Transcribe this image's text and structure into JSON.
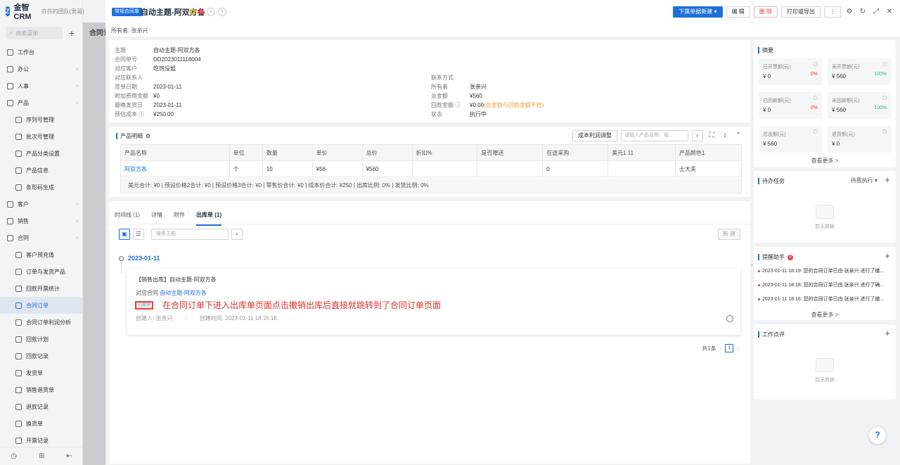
{
  "app": {
    "logo": "金智CRM",
    "team": "芬芬的团队(男哥)",
    "search_placeholder": "搜索菜单",
    "bg_title": "合同订"
  },
  "sidebar": {
    "items": [
      {
        "label": "工作台",
        "sub": false,
        "arrow": false,
        "active": false
      },
      {
        "label": "办公",
        "sub": false,
        "arrow": true,
        "active": false
      },
      {
        "label": "人事",
        "sub": false,
        "arrow": true,
        "active": false
      },
      {
        "label": "产品",
        "sub": false,
        "arrow": true,
        "active": false
      },
      {
        "label": "序列号管理",
        "sub": true,
        "arrow": false,
        "active": false
      },
      {
        "label": "批次号管理",
        "sub": true,
        "arrow": false,
        "active": false
      },
      {
        "label": "产品分类设置",
        "sub": true,
        "arrow": false,
        "active": false
      },
      {
        "label": "产品信息",
        "sub": true,
        "arrow": false,
        "active": false
      },
      {
        "label": "条形码生成",
        "sub": true,
        "arrow": false,
        "active": false
      },
      {
        "label": "客户",
        "sub": false,
        "arrow": true,
        "active": false
      },
      {
        "label": "销售",
        "sub": false,
        "arrow": true,
        "active": false
      },
      {
        "label": "合同",
        "sub": false,
        "arrow": true,
        "active": false
      },
      {
        "label": "客户预充值",
        "sub": true,
        "arrow": false,
        "active": false
      },
      {
        "label": "订单与发货产品",
        "sub": true,
        "arrow": false,
        "active": false
      },
      {
        "label": "回款开票统计",
        "sub": true,
        "arrow": false,
        "active": false
      },
      {
        "label": "合同订单",
        "sub": true,
        "arrow": false,
        "active": true
      },
      {
        "label": "合同订单利润分析",
        "sub": true,
        "arrow": false,
        "active": false
      },
      {
        "label": "回款计划",
        "sub": true,
        "arrow": false,
        "active": false
      },
      {
        "label": "回款记录",
        "sub": true,
        "arrow": false,
        "active": false
      },
      {
        "label": "发货单",
        "sub": true,
        "arrow": false,
        "active": false
      },
      {
        "label": "销售退货单",
        "sub": true,
        "arrow": false,
        "active": false
      },
      {
        "label": "退款记录",
        "sub": true,
        "arrow": false,
        "active": false
      },
      {
        "label": "换货单",
        "sub": true,
        "arrow": false,
        "active": false
      },
      {
        "label": "开票记录",
        "sub": true,
        "arrow": false,
        "active": false
      }
    ]
  },
  "header": {
    "tag": "常规合同单",
    "title": "自动主题-阿双方各",
    "owner": "所有者: 张亲兴",
    "buttons": {
      "downstream": "下属单据新建",
      "edit": "编 辑",
      "delete": "删 除",
      "print": "打印或导出",
      "more": "⋮"
    }
  },
  "info": {
    "left": [
      {
        "label": "主题",
        "value": "自动主题-阿双方各",
        "cls": ""
      },
      {
        "label": "合同单号",
        "value": "DD2023011118004",
        "cls": ""
      },
      {
        "label": "对应客户",
        "value": "吃饱没姐",
        "cls": "link"
      },
      {
        "label": "对应联系人",
        "value": "",
        "cls": ""
      },
      {
        "label": "签单日期",
        "value": "2023-01-11",
        "cls": ""
      },
      {
        "label": "附加费用金额",
        "value": "¥0",
        "cls": ""
      },
      {
        "label": "最晚发货日",
        "value": "2023-01-11",
        "cls": ""
      },
      {
        "label": "预估成本 ⓘ",
        "value": "¥250.00",
        "cls": ""
      }
    ],
    "right": [
      {
        "label": "",
        "value": "",
        "cls": ""
      },
      {
        "label": "",
        "value": "",
        "cls": ""
      },
      {
        "label": "",
        "value": "",
        "cls": ""
      },
      {
        "label": "联系方式",
        "value": "",
        "cls": ""
      },
      {
        "label": "所有者",
        "value": "张亲兴",
        "cls": ""
      },
      {
        "label": "总金额",
        "value": "¥560",
        "cls": ""
      },
      {
        "label": "回款金额 ⓘ",
        "value": "¥0.00",
        "extra": "(总金额与回款金额不符)",
        "cls": ""
      },
      {
        "label": "状态",
        "value": "执行中",
        "cls": ""
      }
    ]
  },
  "products": {
    "title": "产品明细",
    "cost_btn": "成本利润调整",
    "search_placeholder": "请输入产品名称、规...",
    "columns": [
      "产品名称",
      "单位",
      "数量",
      "单价",
      "总价",
      "折扣%",
      "是否赠送",
      "在途采购",
      "美元1.11",
      "产品颜色1"
    ],
    "rows": [
      [
        "阿双方各",
        "个",
        "10",
        "¥56",
        "¥560",
        "",
        "",
        "0",
        "",
        "士大夫"
      ]
    ],
    "summary": "美元合计: ¥0 |  预设价格2合计: ¥0 |  预设价格3合计: ¥0 |  零售价合计: ¥0 |  成本价合计: ¥250 |  出库比例: 0% |  发货比例: 0%"
  },
  "tabs": {
    "items": [
      "时间线 (1)",
      "详情",
      "附件",
      "出库单 (1)"
    ],
    "active_index": 3,
    "search_placeholder": "搜索主题",
    "new_label": "新 建"
  },
  "timeline": {
    "date": "2023-01-11",
    "entry": {
      "title": "【销售出库】自动主题-阿双方各",
      "related_label": "对应合同",
      "related_value": "自动主题-阿双方各",
      "status": "已撤销",
      "note": "在合同订单下进入出库单页面点击撤销出库后直接就跳转到了合同订单页面",
      "creator": "创建人: 张亲兴",
      "created": "创建时间: 2023-01-11 18:15:16"
    },
    "pager": {
      "total": "共1条",
      "page": "1"
    }
  },
  "summary": {
    "title": "摘要",
    "boxes": [
      {
        "label": "已开票额(元)",
        "value": "¥ 0",
        "pct": "0%",
        "pct_cls": "red"
      },
      {
        "label": "未开票额(元)",
        "value": "¥ 560",
        "pct": "100%",
        "pct_cls": "green"
      },
      {
        "label": "已回款额(元)",
        "value": "¥ 0",
        "pct": "0%",
        "pct_cls": "red"
      },
      {
        "label": "未回款额(元)",
        "value": "¥ 560",
        "pct": "100%",
        "pct_cls": "green"
      },
      {
        "label": "总金额(元)",
        "value": "¥ 560",
        "pct": "",
        "pct_cls": ""
      },
      {
        "label": "退货额(元)",
        "value": "¥ 0",
        "pct": "",
        "pct_cls": ""
      }
    ],
    "more": "查看更多 >"
  },
  "tasks": {
    "title": "待办任务",
    "filter": "待我执行",
    "empty": "暂无数据"
  },
  "reminders": {
    "title": "提醒助手",
    "badge": "0",
    "items": [
      "2023-01-11 18:19: 您的合同订单已由 张亲兴 进行了撤...",
      "2023-01-11 18:18: 您的合同订单已由 张亲兴 进行了确...",
      "2023-01-11 18:16: 您的合同订单已由 张亲兴 进行了撤..."
    ],
    "more": "查看更多 >"
  },
  "comments": {
    "title": "工作点评",
    "empty": "暂无数据"
  }
}
